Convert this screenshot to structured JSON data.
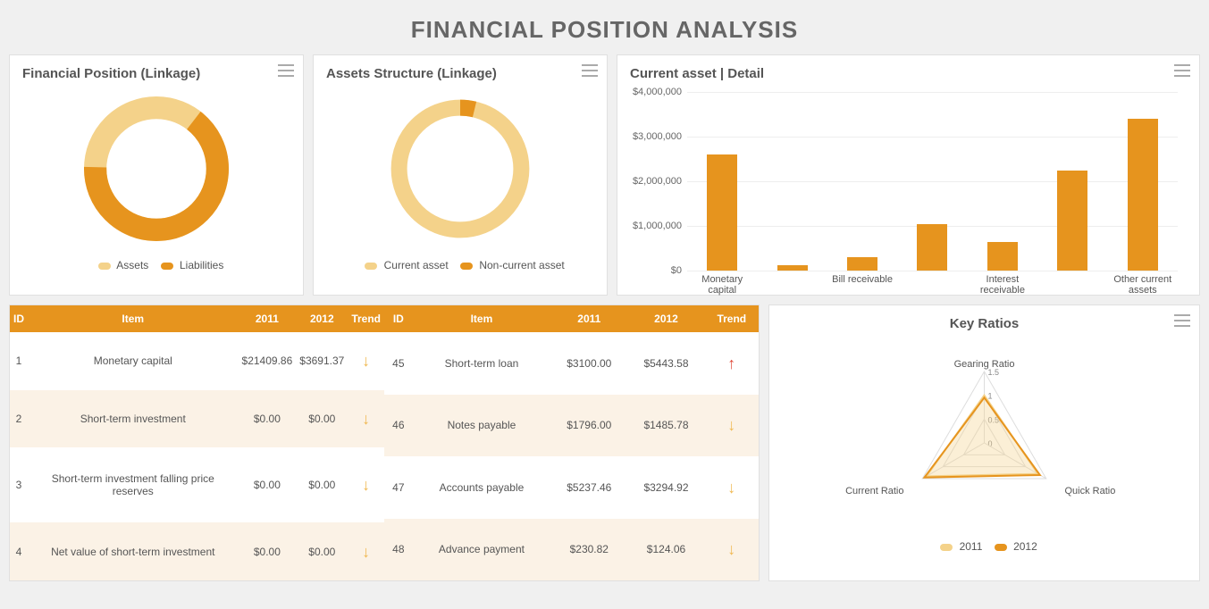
{
  "page_title": "FINANCIAL POSITION ANALYSIS",
  "donut1": {
    "title": "Financial Position (Linkage)",
    "legend": [
      "Assets",
      "Liabilities"
    ]
  },
  "donut2": {
    "title": "Assets Structure (Linkage)",
    "legend": [
      "Current asset",
      "Non-current asset"
    ]
  },
  "bar": {
    "title": "Current asset | Detail"
  },
  "tables": {
    "headers": [
      "ID",
      "Item",
      "2011",
      "2012",
      "Trend"
    ],
    "left": [
      {
        "id": "1",
        "item": "Monetary capital",
        "y2011": "$21409.86",
        "y2012": "$3691.37",
        "trend": "down"
      },
      {
        "id": "2",
        "item": "Short-term investment",
        "y2011": "$0.00",
        "y2012": "$0.00",
        "trend": "down"
      },
      {
        "id": "3",
        "item": "Short-term investment falling price reserves",
        "y2011": "$0.00",
        "y2012": "$0.00",
        "trend": "down"
      },
      {
        "id": "4",
        "item": "Net value of short-term investment",
        "y2011": "$0.00",
        "y2012": "$0.00",
        "trend": "down"
      }
    ],
    "right": [
      {
        "id": "45",
        "item": "Short-term loan",
        "y2011": "$3100.00",
        "y2012": "$5443.58",
        "trend": "up"
      },
      {
        "id": "46",
        "item": "Notes payable",
        "y2011": "$1796.00",
        "y2012": "$1485.78",
        "trend": "down"
      },
      {
        "id": "47",
        "item": "Accounts payable",
        "y2011": "$5237.46",
        "y2012": "$3294.92",
        "trend": "down"
      },
      {
        "id": "48",
        "item": "Advance payment",
        "y2011": "$230.82",
        "y2012": "$124.06",
        "trend": "down"
      }
    ]
  },
  "radar": {
    "title": "Key Ratios",
    "axes": [
      "Gearing Ratio",
      "Quick Ratio",
      "Current Ratio"
    ],
    "ticks": [
      "0",
      "0.5",
      "1",
      "1.5"
    ],
    "legend": [
      "2011",
      "2012"
    ]
  },
  "chart_data": [
    {
      "type": "pie",
      "title": "Financial Position (Linkage)",
      "series": [
        {
          "name": "Assets",
          "value": 35,
          "color": "#f4d28a"
        },
        {
          "name": "Liabilities",
          "value": 65,
          "color": "#e6941e"
        }
      ]
    },
    {
      "type": "pie",
      "title": "Assets Structure (Linkage)",
      "series": [
        {
          "name": "Current asset",
          "value": 95,
          "color": "#f4d28a"
        },
        {
          "name": "Non-current asset",
          "value": 5,
          "color": "#e6941e"
        }
      ]
    },
    {
      "type": "bar",
      "title": "Current asset | Detail",
      "ylabel": "",
      "ylim": [
        0,
        4000000
      ],
      "y_ticks": [
        "$0",
        "$1,000,000",
        "$2,000,000",
        "$3,000,000",
        "$4,000,000"
      ],
      "categories": [
        "Monetary capital",
        "",
        "Bill receivable",
        "",
        "Interest receivable",
        "",
        "Other current assets"
      ],
      "values": [
        2600000,
        120000,
        300000,
        1050000,
        650000,
        2250000,
        3400000
      ],
      "color": "#e6941e"
    },
    {
      "type": "radar",
      "title": "Key Ratios",
      "axes": [
        "Gearing Ratio",
        "Quick Ratio",
        "Current Ratio"
      ],
      "axis_max": 1.5,
      "series": [
        {
          "name": "2011",
          "values": [
            1.0,
            1.3,
            1.4
          ],
          "color": "#f4d28a"
        },
        {
          "name": "2012",
          "values": [
            0.95,
            1.35,
            1.45
          ],
          "color": "#e6941e"
        }
      ]
    }
  ]
}
